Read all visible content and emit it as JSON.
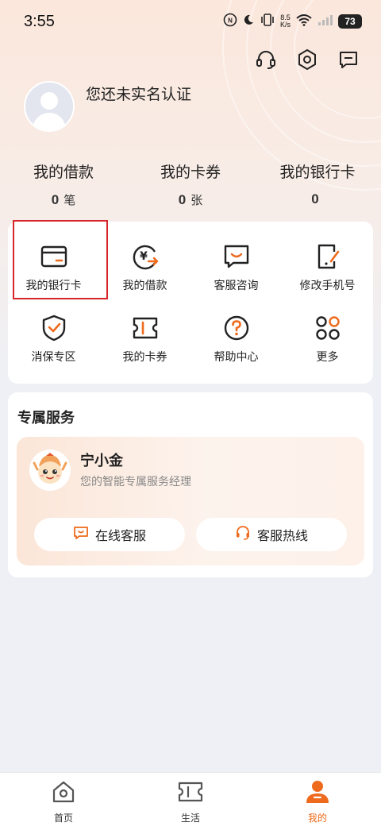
{
  "status_bar": {
    "time": "3:55",
    "net_speed_value": "8.5",
    "net_speed_unit": "K/s",
    "battery": "73"
  },
  "top_actions": {
    "support_icon": "headset-icon",
    "settings_icon": "hexagon-gear-icon",
    "message_icon": "message-icon"
  },
  "profile": {
    "name": "您还未实名认证"
  },
  "stats": [
    {
      "label": "我的借款",
      "value": "0",
      "unit": "笔"
    },
    {
      "label": "我的卡券",
      "value": "0",
      "unit": "张"
    },
    {
      "label": "我的银行卡",
      "value": "0",
      "unit": ""
    }
  ],
  "grid": [
    {
      "label": "我的银行卡",
      "icon": "bank-card-icon"
    },
    {
      "label": "我的借款",
      "icon": "yuan-loan-icon"
    },
    {
      "label": "客服咨询",
      "icon": "chat-support-icon"
    },
    {
      "label": "修改手机号",
      "icon": "phone-edit-icon"
    },
    {
      "label": "消保专区",
      "icon": "shield-check-icon"
    },
    {
      "label": "我的卡券",
      "icon": "coupon-icon"
    },
    {
      "label": "帮助中心",
      "icon": "help-icon"
    },
    {
      "label": "更多",
      "icon": "more-grid-icon"
    }
  ],
  "service": {
    "title": "专属服务",
    "advisor_name": "宁小金",
    "advisor_subtitle": "您的智能专属服务经理",
    "online_button": "在线客服",
    "hotline_button": "客服热线"
  },
  "tabbar": [
    {
      "label": "首页",
      "icon": "home-icon",
      "active": false
    },
    {
      "label": "生活",
      "icon": "ticket-icon",
      "active": false
    },
    {
      "label": "我的",
      "icon": "person-icon",
      "active": true
    }
  ],
  "colors": {
    "accent": "#ee6a1c",
    "highlight": "#d6262c",
    "background": "#eef0f5"
  }
}
